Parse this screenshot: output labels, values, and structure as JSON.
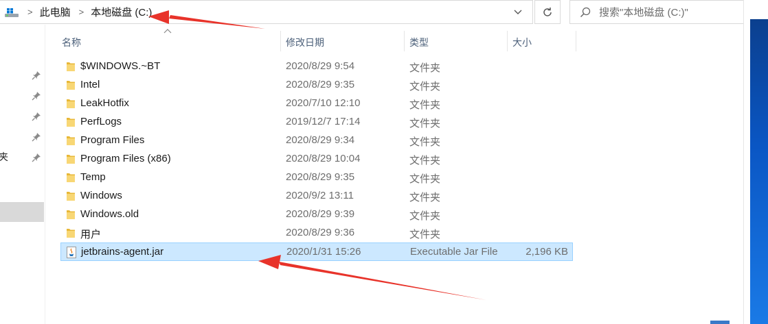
{
  "address_bar": {
    "crumbs": [
      "此电脑",
      "本地磁盘 (C:)"
    ],
    "separator": ">"
  },
  "search": {
    "placeholder": "搜索\"本地磁盘 (C:)\""
  },
  "nav": {
    "partial_label": "夹"
  },
  "columns": {
    "name": "名称",
    "date": "修改日期",
    "type": "类型",
    "size": "大小"
  },
  "files": [
    {
      "name": "$WINDOWS.~BT",
      "date": "2020/8/29 9:54",
      "type": "文件夹",
      "size": "",
      "icon": "folder-icon"
    },
    {
      "name": "Intel",
      "date": "2020/8/29 9:35",
      "type": "文件夹",
      "size": "",
      "icon": "folder-icon"
    },
    {
      "name": "LeakHotfix",
      "date": "2020/7/10 12:10",
      "type": "文件夹",
      "size": "",
      "icon": "folder-icon"
    },
    {
      "name": "PerfLogs",
      "date": "2019/12/7 17:14",
      "type": "文件夹",
      "size": "",
      "icon": "folder-icon"
    },
    {
      "name": "Program Files",
      "date": "2020/8/29 9:34",
      "type": "文件夹",
      "size": "",
      "icon": "folder-icon"
    },
    {
      "name": "Program Files (x86)",
      "date": "2020/8/29 10:04",
      "type": "文件夹",
      "size": "",
      "icon": "folder-icon"
    },
    {
      "name": "Temp",
      "date": "2020/8/29 9:35",
      "type": "文件夹",
      "size": "",
      "icon": "folder-icon"
    },
    {
      "name": "Windows",
      "date": "2020/9/2 13:11",
      "type": "文件夹",
      "size": "",
      "icon": "folder-icon"
    },
    {
      "name": "Windows.old",
      "date": "2020/8/29 9:39",
      "type": "文件夹",
      "size": "",
      "icon": "folder-icon"
    },
    {
      "name": "用户",
      "date": "2020/8/29 9:36",
      "type": "文件夹",
      "size": "",
      "icon": "folder-icon"
    },
    {
      "name": "jetbrains-agent.jar",
      "date": "2020/1/31 15:26",
      "type": "Executable Jar File",
      "size": "2,196 KB",
      "icon": "java-jar-icon",
      "selected": true
    }
  ],
  "colors": {
    "selection_bg": "#cce8ff",
    "selection_border": "#99d1ff",
    "annotation_arrow": "#e8332a",
    "folder": "#f8d775"
  }
}
